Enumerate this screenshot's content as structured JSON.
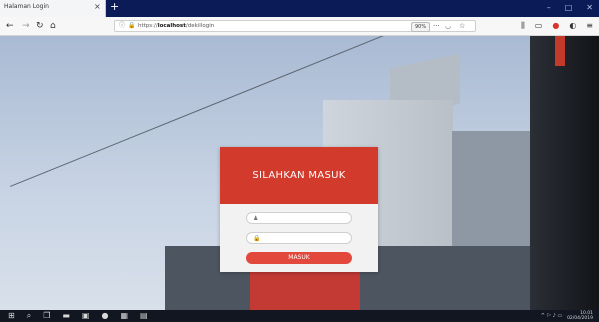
{
  "browser": {
    "tab_title": "Halaman Login",
    "tab_close": "×",
    "new_tab": "+",
    "window_controls": [
      "–",
      "□",
      "✕"
    ],
    "nav": {
      "back": "←",
      "forward": "→",
      "reload": "↻",
      "home": "⌂"
    },
    "url": {
      "info_icon": "ⓘ",
      "lock_icon": "🔒",
      "prefix": "https://",
      "host": "localhost",
      "path": "/dekillogin"
    },
    "zoom": "90%",
    "url_more": "···",
    "pocket_icon": "◡",
    "star_icon": "☆",
    "toolbar_icons": [
      "library-icon",
      "sidebar-icon",
      "adblock-icon",
      "extension-icon",
      "menu-icon"
    ],
    "toolbar_glyphs": [
      "⫼",
      "▭",
      "●",
      "◐",
      "≡"
    ]
  },
  "login": {
    "title": "SILAHKAN MASUK",
    "username_icon": "♟",
    "username_placeholder": "",
    "password_icon": "🔒",
    "password_placeholder": "",
    "submit_label": "MASUK",
    "colors": {
      "header": "#d23a2c",
      "button": "#e2483b"
    }
  },
  "taskbar": {
    "left_glyphs": [
      "⊞",
      "⌕",
      "❐",
      "▬",
      "▣",
      "●",
      "▦",
      "▤"
    ],
    "tray": "^ ⚐ ♪ ▭",
    "time": "10.01",
    "date": "02/04/2019"
  }
}
